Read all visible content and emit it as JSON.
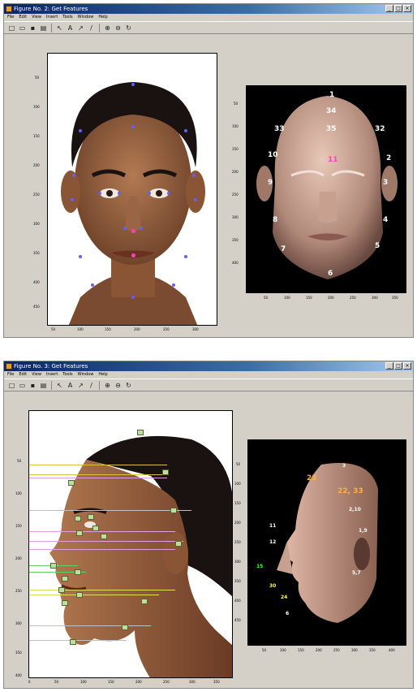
{
  "windows": [
    {
      "title": "Figure No. 2: Get Features",
      "menu": [
        "File",
        "Edit",
        "View",
        "Insert",
        "Tools",
        "Window",
        "Help"
      ],
      "toolbar_icons": [
        "new-icon",
        "open-icon",
        "save-icon",
        "print-icon",
        "arrow-icon",
        "text-icon",
        "arrow-draw-icon",
        "line-icon",
        "zoom-in-icon",
        "zoom-out-icon",
        "rotate-icon"
      ],
      "left_axes": {
        "y_ticks": [
          "50",
          "100",
          "150",
          "200",
          "250",
          "300",
          "350",
          "400",
          "450"
        ],
        "x_ticks": [
          "50",
          "100",
          "150",
          "200",
          "250",
          "300"
        ]
      },
      "right_axes": {
        "y_ticks": [
          "50",
          "100",
          "150",
          "200",
          "250",
          "300",
          "350",
          "400"
        ],
        "x_ticks": [
          "50",
          "100",
          "150",
          "200",
          "250",
          "300",
          "350"
        ],
        "labels": [
          "1",
          "34",
          "35",
          "33",
          "32",
          "10",
          "2",
          "11",
          "9",
          "3",
          "8",
          "4",
          "7",
          "5",
          "6"
        ]
      }
    },
    {
      "title": "Figure No. 3: Get Features",
      "menu": [
        "File",
        "Edit",
        "View",
        "Insert",
        "Tools",
        "Window",
        "Help"
      ],
      "toolbar_icons": [
        "new-icon",
        "open-icon",
        "save-icon",
        "print-icon",
        "arrow-icon",
        "text-icon",
        "arrow-draw-icon",
        "line-icon",
        "zoom-in-icon",
        "zoom-out-icon",
        "rotate-icon"
      ],
      "left_axes": {
        "y_ticks": [
          "50",
          "100",
          "150",
          "200",
          "250",
          "300",
          "350",
          "400"
        ],
        "x_ticks": [
          "0",
          "50",
          "100",
          "150",
          "200",
          "250",
          "300",
          "350"
        ]
      },
      "right_axes": {
        "y_ticks": [
          "50",
          "100",
          "150",
          "200",
          "250",
          "300",
          "350",
          "400",
          "450"
        ],
        "x_ticks": [
          "50",
          "100",
          "150",
          "200",
          "250",
          "300",
          "350",
          "400"
        ],
        "labels": [
          "3",
          "23",
          "22, 33",
          "2,10",
          "11",
          "12",
          "1,9",
          "15",
          "30",
          "24",
          "5,7",
          "6"
        ]
      }
    }
  ],
  "colors": {
    "title_start": "#0a246a",
    "title_end": "#a6caf0",
    "panel": "#d4d0c8",
    "landmark": "#6060ff",
    "highlight": "#ff40c0"
  }
}
